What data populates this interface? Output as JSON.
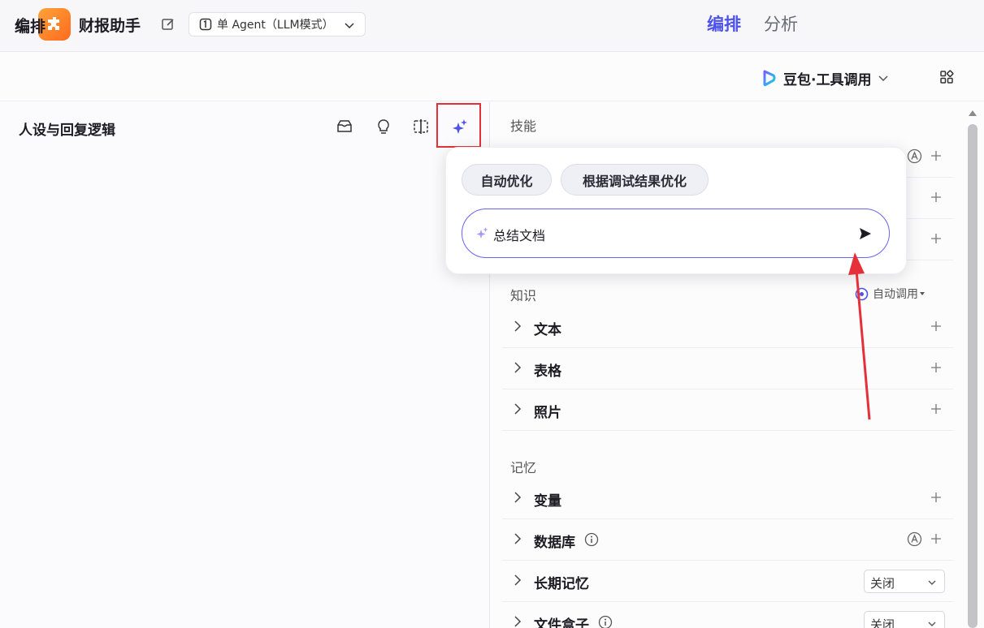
{
  "topbar": {
    "app_name": "财报助手",
    "mode_label": "单 Agent（LLM模式）",
    "tabs": [
      {
        "label": "编排",
        "active": true
      },
      {
        "label": "分析",
        "active": false
      }
    ]
  },
  "subheader": {
    "title": "编排",
    "model_label": "豆包·工具调用"
  },
  "left_panel": {
    "title": "人设与回复逻辑"
  },
  "popup": {
    "chips": [
      "自动优化",
      "根据调试结果优化"
    ],
    "input_value": "总结文档"
  },
  "right_panel": {
    "skills_title": "技能",
    "knowledge": {
      "title": "知识",
      "auto_call_label": "自动调用",
      "items": [
        "文本",
        "表格",
        "照片"
      ]
    },
    "memory": {
      "title": "记忆",
      "items": [
        "变量",
        "数据库",
        "长期记忆",
        "文件盒子"
      ],
      "long_term_memory_value": "关闭",
      "file_box_value": "关闭"
    }
  },
  "colors": {
    "accent": "#4d53e8",
    "highlight_red": "#e5303a"
  }
}
